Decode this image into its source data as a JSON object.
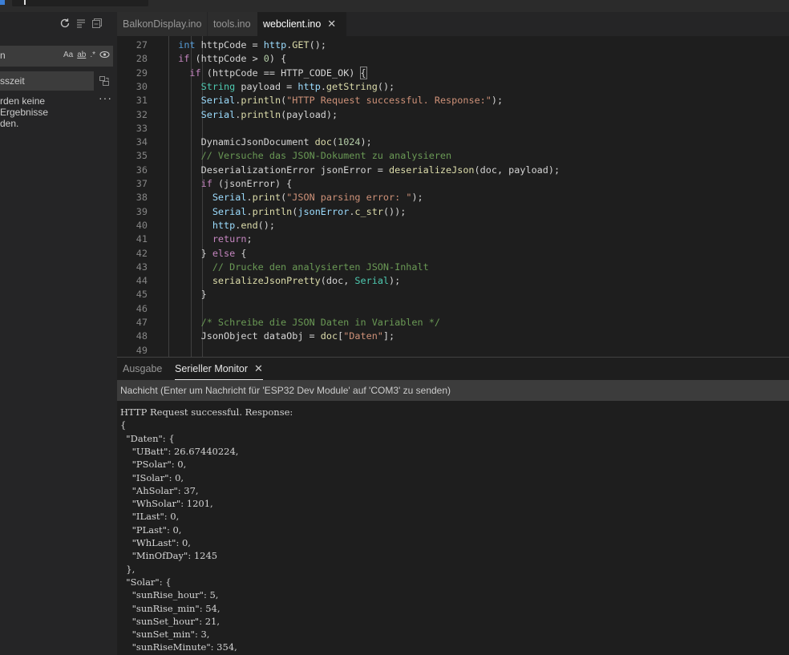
{
  "sidebar": {
    "search_value": "n",
    "search_options": [
      "Aa",
      "ab",
      ".*"
    ],
    "replace_value": "sszeit",
    "no_results_text": "rden keine Ergebnisse\nden."
  },
  "editor_tabs": [
    {
      "label": "BalkonDisplay.ino"
    },
    {
      "label": "tools.ino"
    },
    {
      "label": "webclient.ino",
      "close": "✕"
    }
  ],
  "code": {
    "line_numbers": [
      "27",
      "28",
      "29",
      "30",
      "31",
      "32",
      "33",
      "34",
      "35",
      "36",
      "37",
      "38",
      "39",
      "40",
      "41",
      "42",
      "43",
      "44",
      "45",
      "46",
      "47",
      "48",
      "49"
    ]
  },
  "panel": {
    "tabs": [
      {
        "label": "Ausgabe"
      },
      {
        "label": "Serieller Monitor",
        "close": "✕"
      }
    ],
    "message_placeholder": "Nachicht (Enter um Nachricht für 'ESP32 Dev Module' auf 'COM3' zu senden)",
    "serial_output": [
      "HTTP Request successful. Response:",
      "{",
      "  \"Daten\": {",
      "    \"UBatt\": 26.67440224,",
      "    \"PSolar\": 0,",
      "    \"ISolar\": 0,",
      "    \"AhSolar\": 37,",
      "    \"WhSolar\": 1201,",
      "    \"ILast\": 0,",
      "    \"PLast\": 0,",
      "    \"WhLast\": 0,",
      "    \"MinOfDay\": 1245",
      "  },",
      "  \"Solar\": {",
      "    \"sunRise_hour\": 5,",
      "    \"sunRise_min\": 54,",
      "    \"sunSet_hour\": 21,",
      "    \"sunSet_min\": 3,",
      "    \"sunRiseMinute\": 354,"
    ]
  },
  "colors": {
    "background": "#1e1e1e",
    "sidebar": "#252526",
    "input": "#3c3c3c",
    "keyword": "#569cd6",
    "function": "#dcdcaa",
    "type": "#4ec9b0",
    "string": "#ce9178",
    "number": "#b5cea8",
    "comment": "#6a9955",
    "control": "#c586c0"
  }
}
